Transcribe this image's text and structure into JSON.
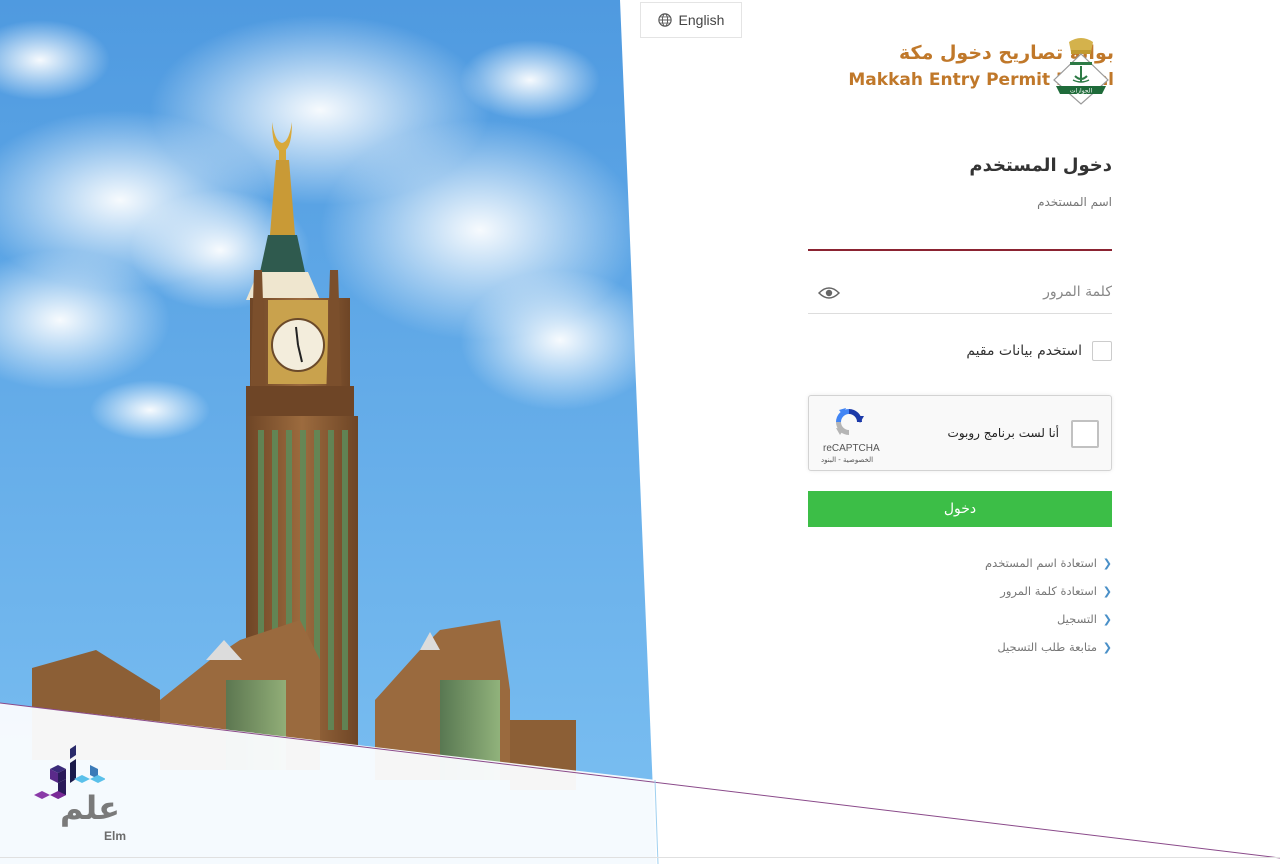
{
  "language": {
    "icon": "globe-icon",
    "label": "English"
  },
  "brand": {
    "title_ar": "بوابة تصاريح دخول مكة",
    "title_en": "Makkah Entry Permit Portal",
    "emblem": "jawazat-emblem-icon",
    "colors": {
      "brand_text": "#c0782a",
      "emblem_green": "#1f6b3a",
      "emblem_gold": "#d4b24c"
    }
  },
  "login": {
    "title": "دخول المستخدم",
    "username_label": "اسم المستخدم",
    "username_value": "",
    "password_placeholder": "كلمة المرور",
    "password_value": "",
    "resident_checkbox_label": "استخدم بيانات مقيم",
    "resident_checked": false,
    "submit_label": "دخول",
    "colors": {
      "username_underline": "#8b2332",
      "submit_bg": "#3cbe47",
      "link_chevron": "#4a90c8"
    }
  },
  "recaptcha": {
    "label": "أنا لست برنامج روبوت",
    "brand": "reCAPTCHA",
    "links": "الخصوصية - البنود",
    "checked": false
  },
  "links": [
    {
      "label": "استعادة اسم المستخدم"
    },
    {
      "label": "استعادة كلمة المرور"
    },
    {
      "label": "التسجيل"
    },
    {
      "label": "متابعة طلب التسجيل"
    }
  ],
  "footer": {
    "elm_logo_ar": "علم",
    "elm_logo_en": "Elm"
  },
  "hero": {
    "subject": "Makkah Royal Clock Tower against blue sky",
    "colors": {
      "sky": "#5aa5e6",
      "cloud": "#e8f1fa",
      "tower_stone": "#8a5a34",
      "clock_face": "#f2ead6",
      "gold": "#d4a73a"
    }
  }
}
